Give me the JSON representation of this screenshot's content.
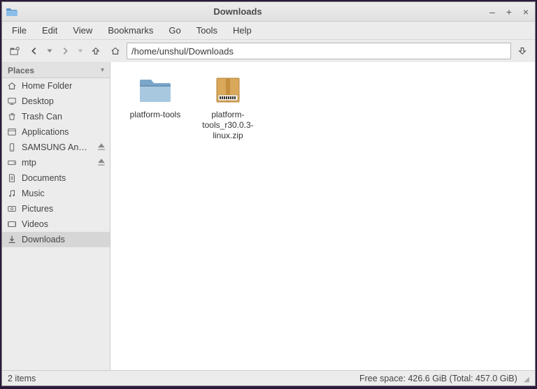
{
  "window": {
    "title": "Downloads"
  },
  "menu": {
    "file": "File",
    "edit": "Edit",
    "view": "View",
    "bookmarks": "Bookmarks",
    "go": "Go",
    "tools": "Tools",
    "help": "Help"
  },
  "path": "/home/unshul/Downloads",
  "sidebar": {
    "header": "Places",
    "items": [
      {
        "label": "Home Folder"
      },
      {
        "label": "Desktop"
      },
      {
        "label": "Trash Can"
      },
      {
        "label": "Applications"
      },
      {
        "label": "SAMSUNG An…",
        "eject": true
      },
      {
        "label": "mtp",
        "eject": true
      },
      {
        "label": "Documents"
      },
      {
        "label": "Music"
      },
      {
        "label": "Pictures"
      },
      {
        "label": "Videos"
      },
      {
        "label": "Downloads",
        "active": true
      }
    ]
  },
  "files": [
    {
      "name": "platform-tools",
      "type": "folder"
    },
    {
      "name": "platform-tools_r30.0.3-linux.zip",
      "type": "archive"
    }
  ],
  "status": {
    "left": "2 items",
    "right": "Free space: 426.6 GiB (Total: 457.0 GiB)"
  }
}
